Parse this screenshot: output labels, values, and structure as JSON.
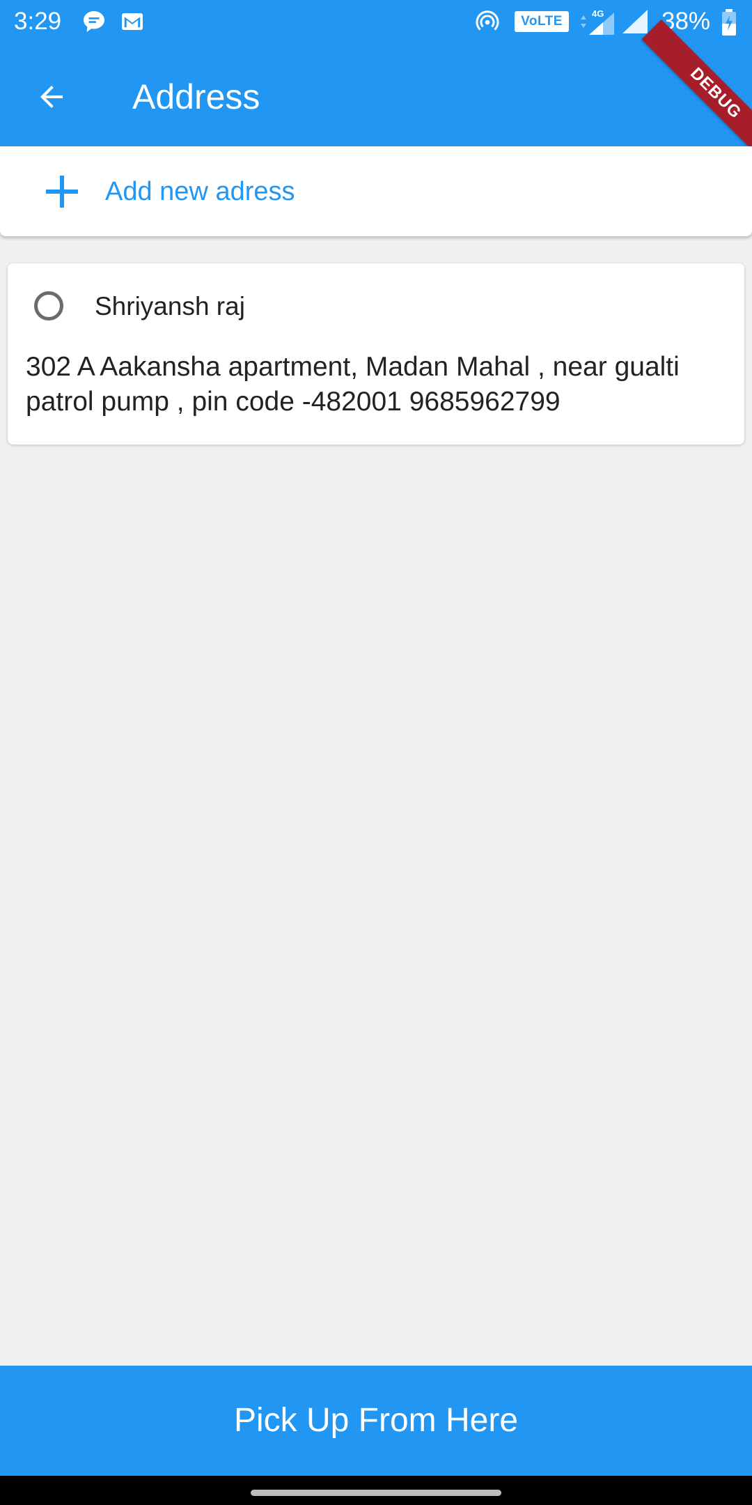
{
  "status_bar": {
    "time": "3:29",
    "network_badge": "VoLTE",
    "network_type": "4G",
    "battery": "38%",
    "left_icons": [
      "chat-notification-icon",
      "gmail-icon"
    ],
    "right_icons": [
      "hotspot-icon",
      "volte-icon",
      "signal-4g-icon",
      "signal-icon",
      "battery-charging-icon"
    ]
  },
  "debug_banner": "DEBUG",
  "app_bar": {
    "title": "Address",
    "back_icon": "arrow-back-icon"
  },
  "add_address": {
    "label": "Add new adress",
    "icon": "plus-icon"
  },
  "addresses": [
    {
      "name": "Shriyansh raj",
      "text": "302 A Aakansha apartment, Madan Mahal , near gualti patrol pump , pin code -482001 9685962799",
      "selected": false
    }
  ],
  "action_button": {
    "label": "Pick Up From Here"
  },
  "colors": {
    "primary": "#2196f3",
    "background": "#f0f0f0",
    "debug_banner": "#a71d2a",
    "text": "#222222",
    "radio": "#6b6b6b"
  }
}
